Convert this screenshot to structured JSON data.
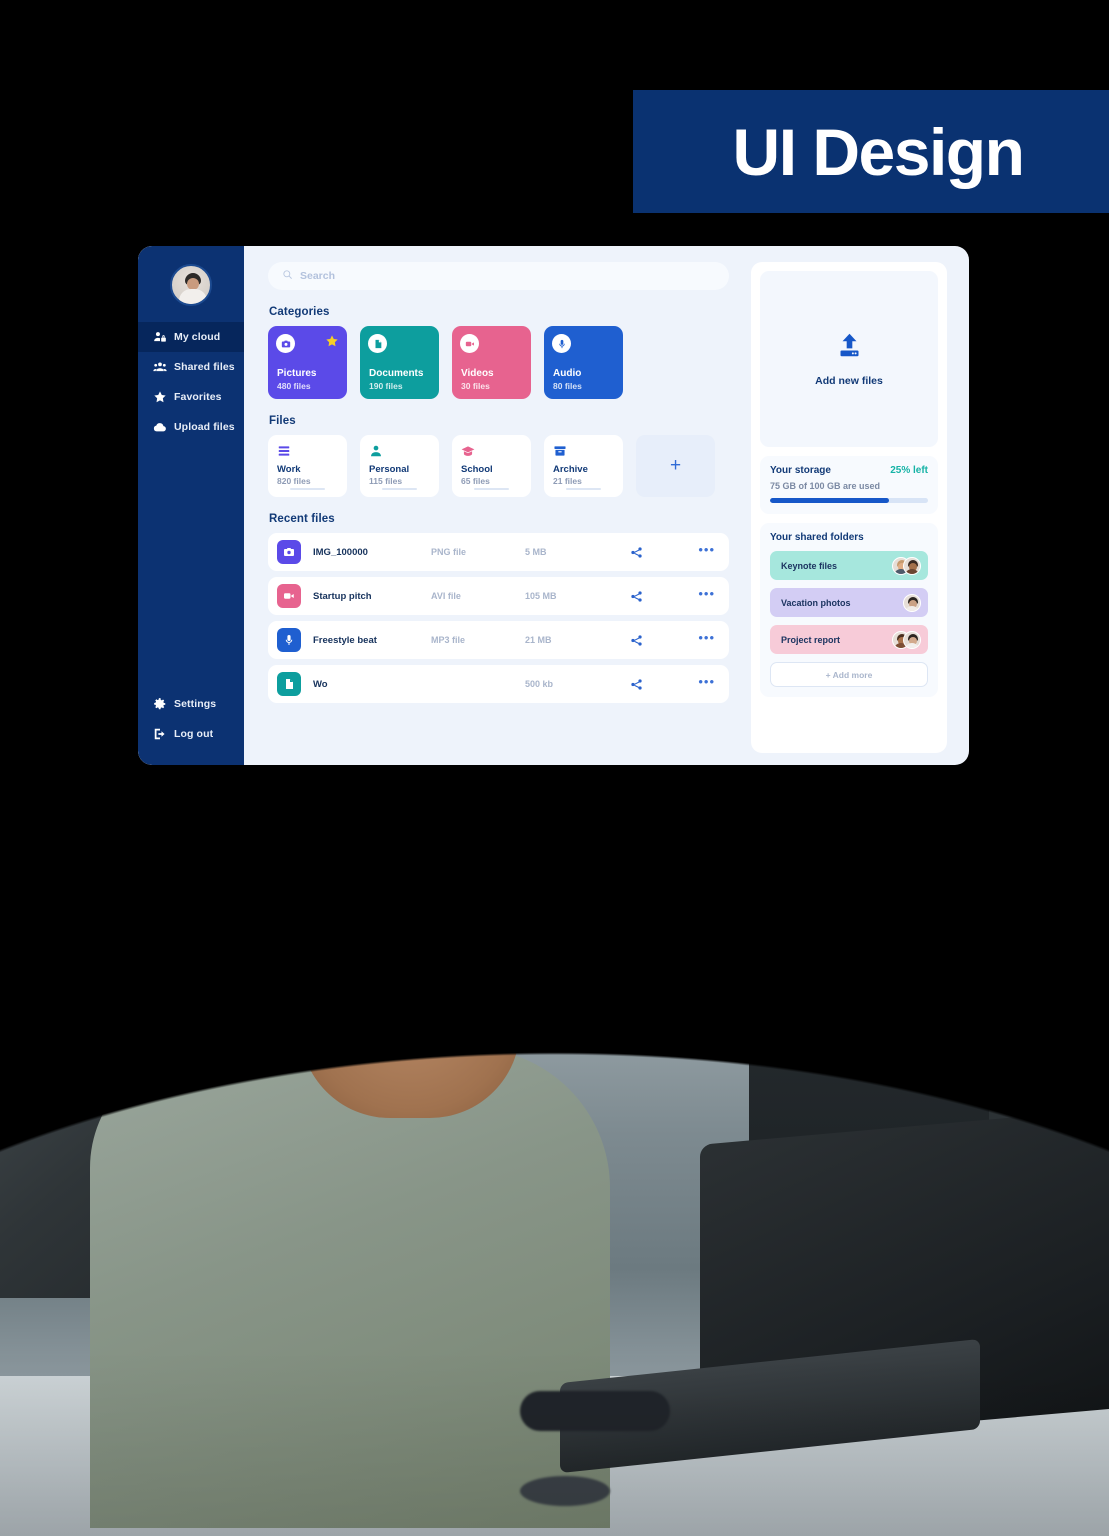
{
  "banner": {
    "title": "UI Design",
    "bg": "#0a3271"
  },
  "sidebar": {
    "avatar_name": "user-avatar",
    "items": [
      {
        "label": "My cloud",
        "icon": "user-lock-icon",
        "active": true
      },
      {
        "label": "Shared files",
        "icon": "users-icon",
        "active": false
      },
      {
        "label": "Favorites",
        "icon": "star-icon",
        "active": false
      },
      {
        "label": "Upload files",
        "icon": "cloud-upload-icon",
        "active": false
      }
    ],
    "bottom_items": [
      {
        "label": "Settings",
        "icon": "gear-icon"
      },
      {
        "label": "Log out",
        "icon": "logout-icon"
      }
    ]
  },
  "search": {
    "placeholder": "Search",
    "icon": "search-icon"
  },
  "categories": {
    "title": "Categories",
    "items": [
      {
        "name": "Pictures",
        "count": "480 files",
        "color": "#5b4ae8",
        "icon": "camera-icon",
        "starred": true
      },
      {
        "name": "Documents",
        "count": "190 files",
        "color": "#0d9e9e",
        "icon": "document-icon",
        "starred": false
      },
      {
        "name": "Videos",
        "count": "30 files",
        "color": "#e7638f",
        "icon": "video-icon",
        "starred": false
      },
      {
        "name": "Audio",
        "count": "80 files",
        "color": "#1f5fd0",
        "icon": "microphone-icon",
        "starred": false
      }
    ]
  },
  "files": {
    "title": "Files",
    "folders": [
      {
        "name": "Work",
        "count": "820 files",
        "icon": "list-icon",
        "color": "#5b4ae8"
      },
      {
        "name": "Personal",
        "count": "115 files",
        "icon": "person-icon",
        "color": "#0d9e9e"
      },
      {
        "name": "School",
        "count": "65 files",
        "icon": "graduation-icon",
        "color": "#e7638f"
      },
      {
        "name": "Archive",
        "count": "21 files",
        "icon": "box-icon",
        "color": "#1f5fd0"
      }
    ],
    "add_label": "+"
  },
  "recent": {
    "title": "Recent files",
    "rows": [
      {
        "name": "IMG_100000",
        "type": "PNG file",
        "size": "5 MB",
        "color": "#5b4ae8",
        "icon": "camera-icon",
        "share_icon": "share-icon",
        "more_icon": "more-icon"
      },
      {
        "name": "Startup pitch",
        "type": "AVI file",
        "size": "105 MB",
        "color": "#e7638f",
        "icon": "video-icon",
        "share_icon": "share-icon",
        "more_icon": "more-icon"
      },
      {
        "name": "Freestyle beat",
        "type": "MP3 file",
        "size": "21 MB",
        "color": "#1f5fd0",
        "icon": "microphone-icon",
        "share_icon": "share-icon",
        "more_icon": "more-icon"
      },
      {
        "name": "Wo",
        "type": "",
        "size": "500 kb",
        "color": "#0d9e9e",
        "icon": "document-icon",
        "share_icon": "share-icon",
        "more_icon": "more-icon"
      }
    ]
  },
  "rail": {
    "upload": {
      "label": "Add new files",
      "icon": "upload-icon"
    },
    "storage": {
      "title": "Your storage",
      "left": "25% left",
      "detail": "75 GB of 100 GB are used",
      "percent_used": 75,
      "fill_color": "#1657c8",
      "left_color": "#16b3a6"
    },
    "shared": {
      "title": "Your shared folders",
      "folders": [
        {
          "name": "Keynote files",
          "color": "#a6e7dd",
          "avatars": 2
        },
        {
          "name": "Vacation photos",
          "color": "#d3cdf4",
          "avatars": 1
        },
        {
          "name": "Project report",
          "color": "#f7cbd8",
          "avatars": 2
        }
      ],
      "add_more": "+ Add more"
    }
  },
  "photo": {
    "alt": "man-working-on-laptop-photo"
  }
}
